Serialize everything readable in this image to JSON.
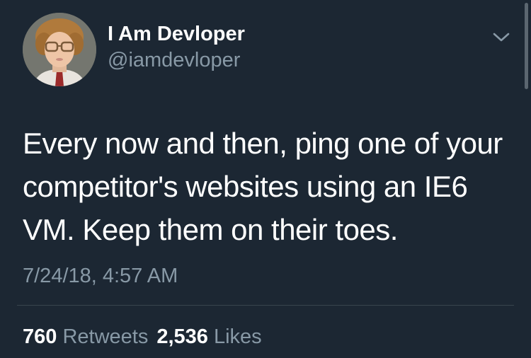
{
  "tweet": {
    "author": {
      "display_name": "I Am Devloper",
      "handle": "@iamdevloper"
    },
    "text": "Every now and then, ping one of your competitor's websites using an IE6 VM. Keep them on their toes.",
    "timestamp": "7/24/18, 4:57 AM",
    "stats": {
      "retweets_count": "760",
      "retweets_label": "Retweets",
      "likes_count": "2,536",
      "likes_label": "Likes"
    }
  },
  "colors": {
    "background": "#1c2733",
    "primary_text": "#ffffff",
    "secondary_text": "#8899a6",
    "divider": "#38444d"
  },
  "icons": {
    "menu": "chevron-down-icon",
    "avatar": "avatar"
  }
}
